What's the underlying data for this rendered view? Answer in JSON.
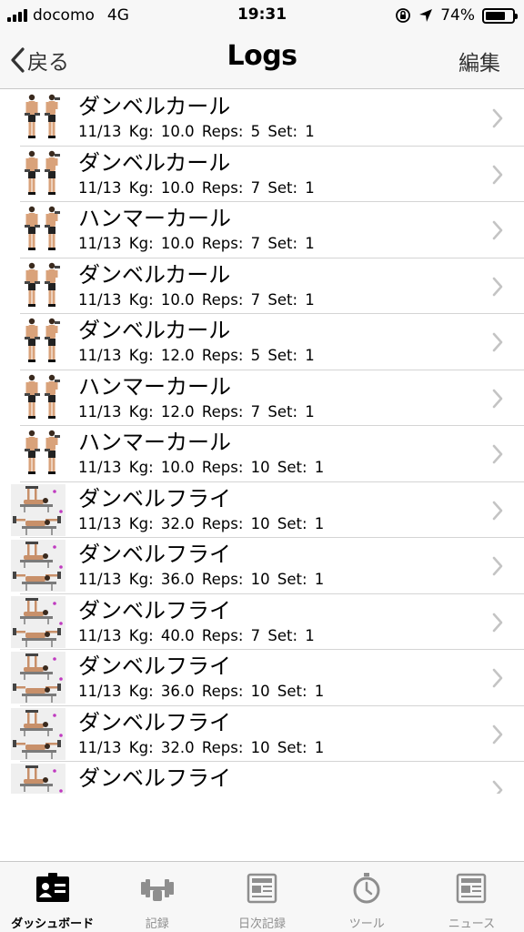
{
  "status_bar": {
    "carrier": "docomo",
    "network": "4G",
    "time": "19:31",
    "battery_pct": "74%",
    "battery_level": 0.74
  },
  "nav": {
    "back_label": "戻る",
    "title": "Logs",
    "edit_label": "編集"
  },
  "rows": [
    {
      "title": "ダンベルカール",
      "sub": "11/13  Kg: 10.0  Reps: 5  Set: 1",
      "thumb": "dumbbell-curl"
    },
    {
      "title": "ダンベルカール",
      "sub": "11/13  Kg: 10.0  Reps: 7  Set: 1",
      "thumb": "dumbbell-curl"
    },
    {
      "title": "ハンマーカール",
      "sub": "11/13  Kg: 10.0  Reps: 7  Set: 1",
      "thumb": "hammer-curl"
    },
    {
      "title": "ダンベルカール",
      "sub": "11/13  Kg: 10.0  Reps: 7  Set: 1",
      "thumb": "dumbbell-curl"
    },
    {
      "title": "ダンベルカール",
      "sub": "11/13  Kg: 12.0  Reps: 5  Set: 1",
      "thumb": "dumbbell-curl"
    },
    {
      "title": "ハンマーカール",
      "sub": "11/13  Kg: 12.0  Reps: 7  Set: 1",
      "thumb": "hammer-curl"
    },
    {
      "title": "ハンマーカール",
      "sub": "11/13  Kg: 10.0  Reps: 10  Set: 1",
      "thumb": "hammer-curl"
    },
    {
      "title": "ダンベルフライ",
      "sub": "11/13  Kg: 32.0  Reps: 10  Set: 1",
      "thumb": "dumbbell-fly"
    },
    {
      "title": "ダンベルフライ",
      "sub": "11/13  Kg: 36.0  Reps: 10  Set: 1",
      "thumb": "dumbbell-fly"
    },
    {
      "title": "ダンベルフライ",
      "sub": "11/13  Kg: 40.0  Reps: 7  Set: 1",
      "thumb": "dumbbell-fly"
    },
    {
      "title": "ダンベルフライ",
      "sub": "11/13  Kg: 36.0  Reps: 10  Set: 1",
      "thumb": "dumbbell-fly"
    },
    {
      "title": "ダンベルフライ",
      "sub": "11/13  Kg: 32.0  Reps: 10  Set: 1",
      "thumb": "dumbbell-fly"
    },
    {
      "title": "ダンベルフライ",
      "sub": "",
      "thumb": "dumbbell-fly"
    }
  ],
  "tabs": [
    {
      "label": "ダッシュボード",
      "icon": "dashboard-icon",
      "active": true
    },
    {
      "label": "記録",
      "icon": "barbell-icon",
      "active": false
    },
    {
      "label": "日次記録",
      "icon": "daily-log-icon",
      "active": false
    },
    {
      "label": "ツール",
      "icon": "stopwatch-icon",
      "active": false
    },
    {
      "label": "ニュース",
      "icon": "news-icon",
      "active": false
    }
  ],
  "colors": {
    "bar_bg": "#f7f7f7",
    "separator": "#d4d4d4",
    "chevron": "#c4c4c4",
    "tab_inactive": "#8e8e8e",
    "tab_active": "#000000"
  }
}
